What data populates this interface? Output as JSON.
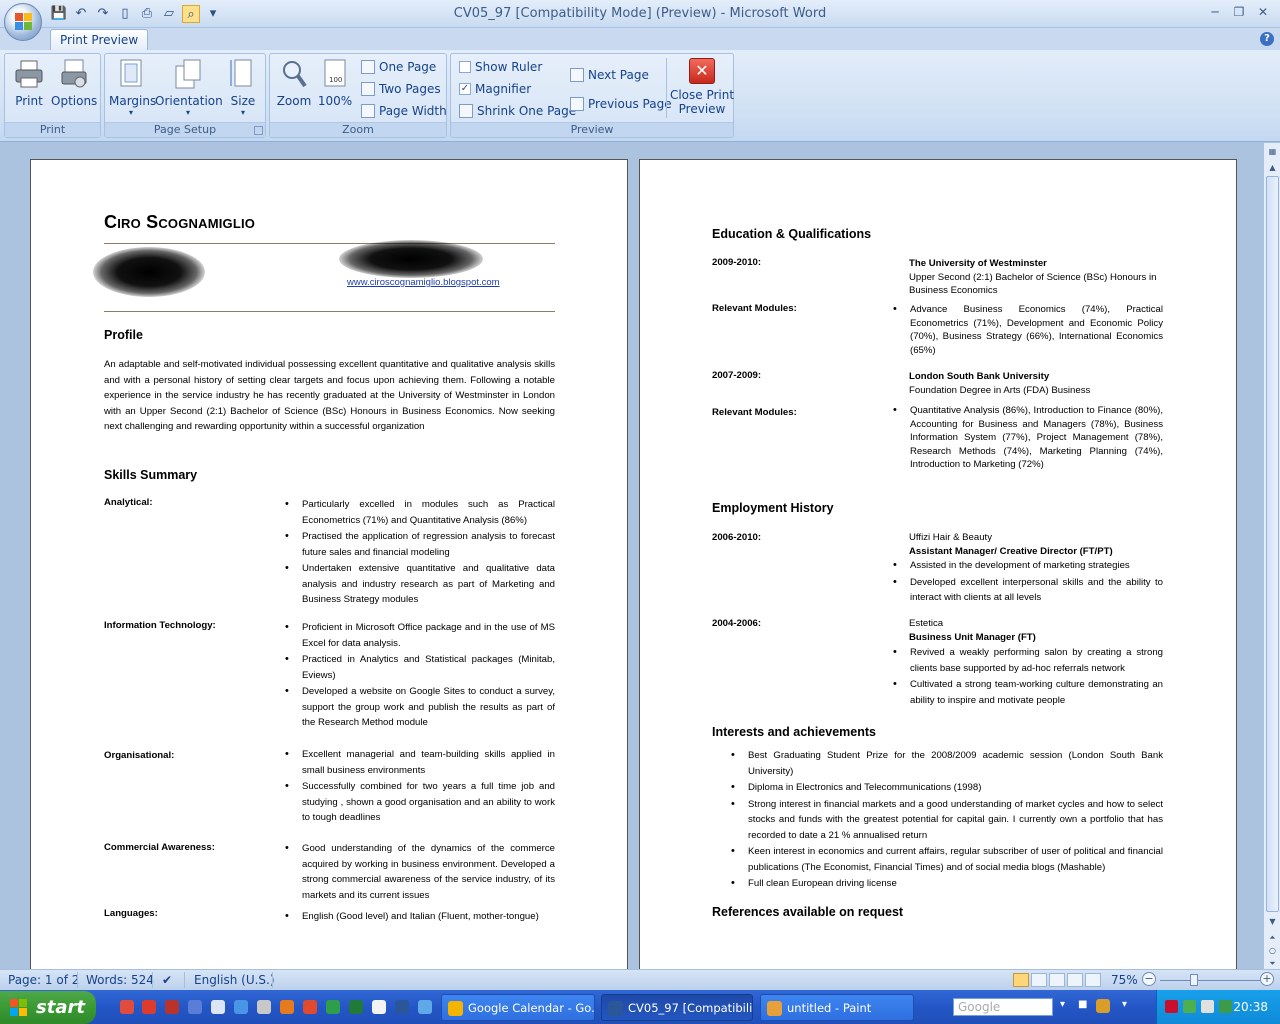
{
  "window": {
    "title": "CV05_97 [Compatibility Mode] (Preview) - Microsoft Word",
    "minimize_glyph": "─",
    "restore_glyph": "❐",
    "close_glyph": "✕",
    "help_glyph": "?"
  },
  "tab": {
    "label": "Print Preview"
  },
  "ribbon": {
    "groups": {
      "print": {
        "label": "Print",
        "print_btn": "Print",
        "options_btn": "Options"
      },
      "page_setup": {
        "label": "Page Setup",
        "margins": "Margins",
        "orientation": "Orientation",
        "size": "Size"
      },
      "zoom": {
        "label": "Zoom",
        "zoom_btn": "Zoom",
        "hundred": "100%",
        "one_page": "One Page",
        "two_pages": "Two Pages",
        "page_width": "Page Width"
      },
      "preview": {
        "label": "Preview",
        "show_ruler": "Show Ruler",
        "magnifier": "Magnifier",
        "shrink": "Shrink One Page",
        "next_page": "Next Page",
        "prev_page": "Previous Page",
        "close_line1": "Close Print",
        "close_line2": "Preview"
      }
    },
    "magnifier_checked": true,
    "show_ruler_checked": false
  },
  "cv": {
    "name": "Ciro Scognamiglio",
    "website": "www.ciroscognamiglio.blogspot.com",
    "profile_heading": "Profile",
    "profile_text": "An adaptable and self-motivated individual possessing excellent quantitative and qualitative analysis skills and with a personal history of setting clear targets and focus upon achieving them. Following a notable experience in the service industry he has recently graduated at the University of Westminster in London with an Upper Second (2:1) Bachelor of Science (BSc) Honours in Business Economics. Now seeking next challenging and rewarding opportunity within a successful organization",
    "skills_heading": "Skills Summary",
    "skills": {
      "analytical": {
        "label": "Analytical:",
        "items": [
          "Particularly excelled in modules such as Practical Econometrics (71%) and Quantitative Analysis (86%)",
          "Practised the application of regression analysis to forecast future sales and financial modeling",
          "Undertaken extensive quantitative and qualitative data analysis and industry research as part of Marketing and Business Strategy modules"
        ]
      },
      "it": {
        "label": "Information Technology:",
        "items": [
          "Proficient in Microsoft Office package and in the use of MS Excel for data analysis.",
          "Practiced in Analytics and Statistical packages (Minitab, Eviews)",
          "Developed a website on Google Sites to conduct a survey, support the group work and publish the results as part of the Research Method module"
        ]
      },
      "org": {
        "label": "Organisational:",
        "items": [
          "Excellent managerial and team-building skills applied in small business environments",
          "Successfully combined for two years a full time job and studying , shown a good organisation and an ability to work to tough deadlines"
        ]
      },
      "commercial": {
        "label": "Commercial Awareness:",
        "items": [
          "Good understanding of the dynamics of the commerce acquired by working in business environment. Developed a strong commercial awareness of the service industry, of its markets and its current issues"
        ]
      },
      "languages": {
        "label": "Languages:",
        "items": [
          "English (Good level) and Italian (Fluent, mother-tongue)"
        ]
      }
    },
    "education_heading": "Education & Qualifications",
    "edu1": {
      "date": "2009-2010:",
      "school": "The University of Westminster",
      "degree": "Upper Second (2:1) Bachelor of Science (BSc) Honours in Business Economics"
    },
    "edu1_modules": {
      "label": "Relevant Modules:",
      "text": "Advance Business Economics (74%), Practical Econometrics (71%), Development and Economic Policy (70%), Business Strategy (66%), International Economics (65%)"
    },
    "edu2": {
      "date": "2007-2009:",
      "school": "London South Bank University",
      "degree": "Foundation Degree in Arts (FDA) Business"
    },
    "edu2_modules": {
      "label": "Relevant Modules:",
      "text": "Quantitative Analysis (86%), Introduction to Finance (80%), Accounting for Business and Managers (78%), Business Information System (77%), Project Management (78%), Research Methods (74%), Marketing Planning (74%), Introduction to Marketing (72%)"
    },
    "employment_heading": "Employment History",
    "job1": {
      "date": "2006-2010:",
      "company": "Uffizi Hair & Beauty",
      "role": "Assistant Manager/ Creative Director (FT/PT)",
      "items": [
        "Assisted in the development of marketing strategies",
        "Developed excellent interpersonal skills and the ability to interact with clients at all levels"
      ]
    },
    "job2": {
      "date": "2004-2006:",
      "company": "Estetica",
      "role": "Business Unit Manager (FT)",
      "items": [
        "Revived a weakly performing salon by creating a strong clients base supported by ad-hoc referrals network",
        "Cultivated a strong team-working culture demonstrating an ability to inspire and motivate people"
      ]
    },
    "interests_heading": "Interests and achievements",
    "interests": [
      "Best Graduating Student Prize for the 2008/2009 academic session (London South Bank University)",
      "Diploma in Electronics and Telecommunications (1998)",
      "Strong interest in financial markets and a good understanding of market cycles and how to select stocks and funds with the greatest potential for capital gain. I currently own a portfolio that has recorded to date a 21 % annualised return",
      "Keen interest in economics and current affairs, regular subscriber of user of political and financial publications (The Economist, Financial Times) and of social media blogs (Mashable)",
      "Full clean European driving license"
    ],
    "references": "References available on request"
  },
  "status": {
    "page": "Page: 1 of 2",
    "words": "Words: 524",
    "language": "English (U.S.)",
    "zoom": "75%",
    "zoom_minus": "−",
    "zoom_plus": "+"
  },
  "taskbar": {
    "start": "start",
    "tasks": [
      {
        "label": "Google Calendar - Go...",
        "color": "#f4b400"
      },
      {
        "label": "CV05_97 [Compatibili...",
        "color": "#2b579a"
      },
      {
        "label": "untitled - Paint",
        "color": "#e8a13a"
      }
    ],
    "search_placeholder": "Google",
    "clock": "20:38"
  }
}
